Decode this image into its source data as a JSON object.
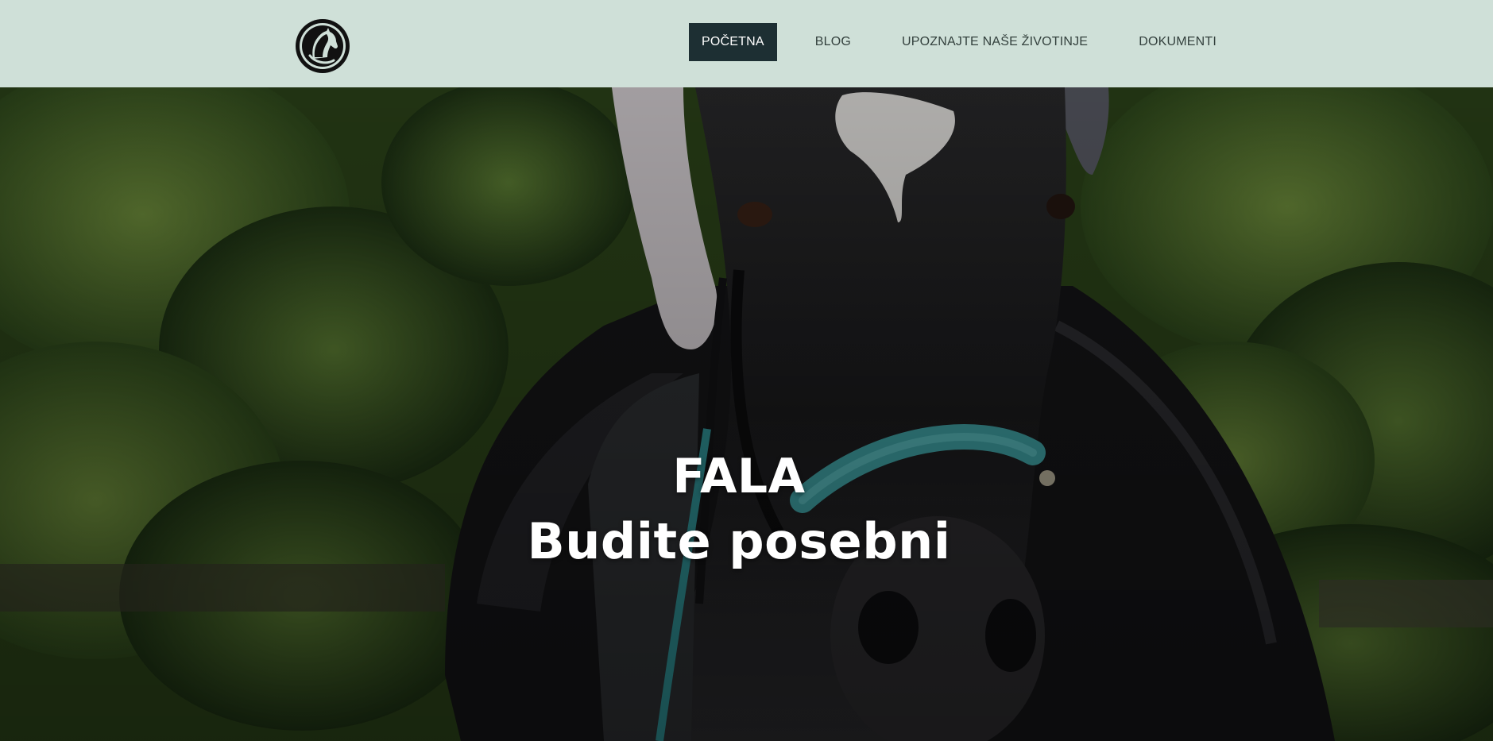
{
  "header": {
    "logo_icon": "horse-head-logo",
    "background_color": "#cfe0d8",
    "nav": {
      "items": [
        {
          "label": "POČETNA",
          "active": true
        },
        {
          "label": "BLOG",
          "active": false
        },
        {
          "label": "UPOZNAJTE NAŠE ŽIVOTINJE",
          "active": false
        },
        {
          "label": "DOKUMENTI",
          "active": false
        }
      ],
      "active_color": "#1d2f33"
    }
  },
  "hero": {
    "title": "FALA",
    "subtitle": "Budite posebni",
    "image_subject": "black horse with white blaze wearing teal halter, rider in saddle, green foliage background"
  }
}
